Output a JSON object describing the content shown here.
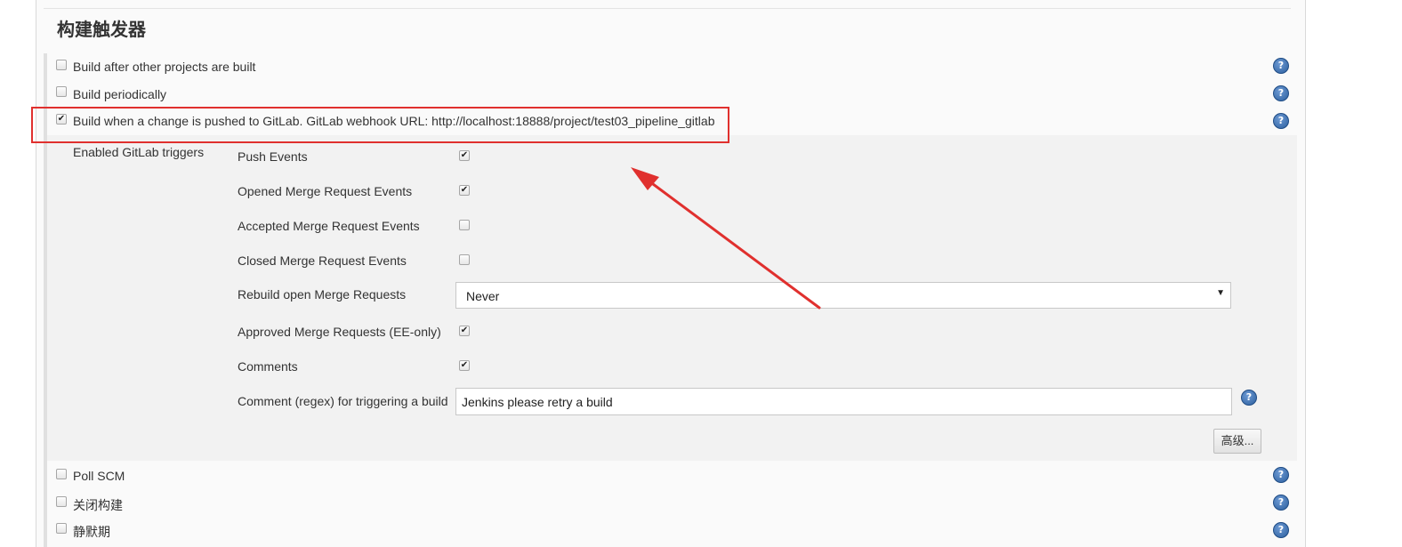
{
  "section": {
    "title": "构建触发器"
  },
  "triggers": [
    {
      "label": "Build after other projects are built",
      "checked": false
    },
    {
      "label": "Build periodically",
      "checked": false
    },
    {
      "label": "Build when a change is pushed to GitLab. GitLab webhook URL: http://localhost:18888/project/test03_pipeline_gitlab",
      "checked": true
    }
  ],
  "gitlab": {
    "group_label": "Enabled GitLab triggers",
    "options": [
      {
        "label": "Push Events",
        "checked": true
      },
      {
        "label": "Opened Merge Request Events",
        "checked": true
      },
      {
        "label": "Accepted Merge Request Events",
        "checked": false
      },
      {
        "label": "Closed Merge Request Events",
        "checked": false
      }
    ],
    "rebuild": {
      "label": "Rebuild open Merge Requests",
      "value": "Never"
    },
    "approved": {
      "label": "Approved Merge Requests (EE-only)",
      "checked": true
    },
    "comments": {
      "label": "Comments",
      "checked": true
    },
    "regex": {
      "label": "Comment (regex) for triggering a build",
      "value": "Jenkins please retry a build"
    },
    "advanced_label": "高级..."
  },
  "more_triggers": [
    {
      "label": "Poll SCM",
      "checked": false
    },
    {
      "label": "关闭构建",
      "checked": false
    },
    {
      "label": "静默期",
      "checked": false
    }
  ],
  "icons": {
    "help": "help-icon",
    "check": "checkmark-icon",
    "dropdown": "chevron-down-icon"
  },
  "help_glyph": "?",
  "check_glyph": "✔",
  "arrow_glyph": "▼",
  "colors": {
    "annotation": "#e0302e",
    "help": "#2c5f9e"
  }
}
